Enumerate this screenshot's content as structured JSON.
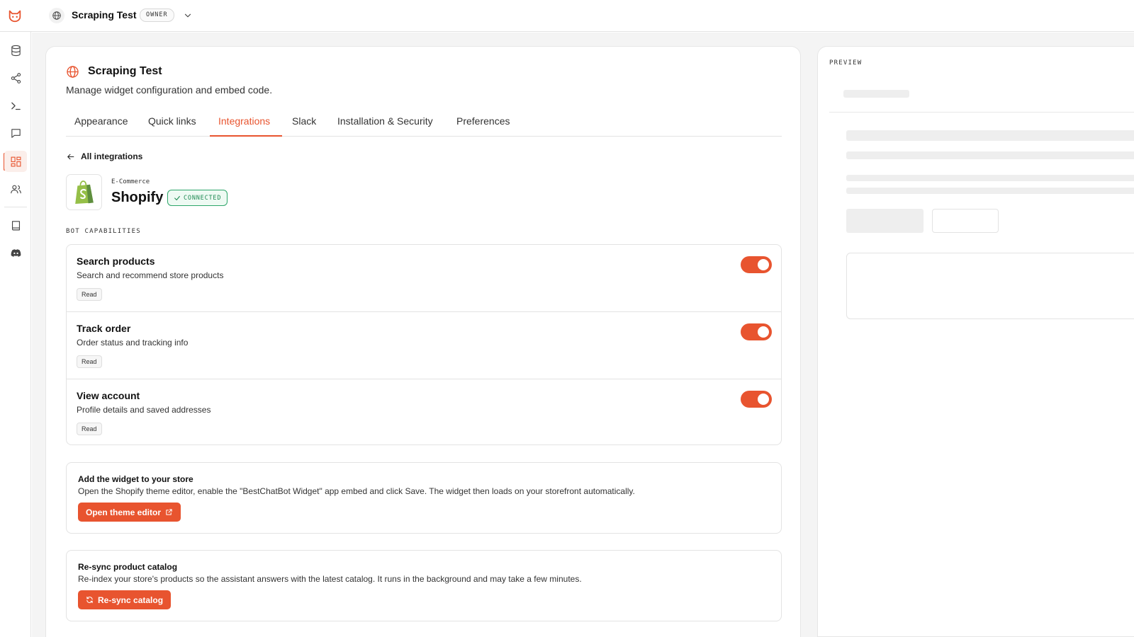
{
  "workspace": {
    "name": "Scraping Test",
    "role": "OWNER"
  },
  "page": {
    "title": "Scraping Test",
    "subtitle": "Manage widget configuration and embed code."
  },
  "tabs": [
    {
      "label": "Appearance"
    },
    {
      "label": "Quick links"
    },
    {
      "label": "Integrations"
    },
    {
      "label": "Slack"
    },
    {
      "label": "Installation & Security"
    },
    {
      "label": "Preferences"
    }
  ],
  "active_tab": "Integrations",
  "back_link": "All integrations",
  "integration": {
    "category": "E-Commerce",
    "name": "Shopify",
    "status": "CONNECTED"
  },
  "capabilities_label": "BOT CAPABILITIES",
  "capabilities": [
    {
      "title": "Search products",
      "description": "Search and recommend store products",
      "badge": "Read",
      "enabled": true
    },
    {
      "title": "Track order",
      "description": "Order status and tracking info",
      "badge": "Read",
      "enabled": true
    },
    {
      "title": "View account",
      "description": "Profile details and saved addresses",
      "badge": "Read",
      "enabled": true
    }
  ],
  "add_widget": {
    "title": "Add the widget to your store",
    "description": "Open the Shopify theme editor, enable the \"BestChatBot Widget\" app embed and click Save. The widget then loads on your storefront automatically.",
    "button": "Open theme editor"
  },
  "resync": {
    "title": "Re-sync product catalog",
    "description": "Re-index your store's products so the assistant answers with the latest catalog. It runs in the background and may take a few minutes.",
    "button": "Re-sync catalog"
  },
  "preview": {
    "label": "PREVIEW"
  },
  "colors": {
    "accent": "#e8542f",
    "success": "#2ea66a",
    "shopify_green": "#95bf47"
  },
  "sidebar_icons": [
    "database-icon",
    "share-icon",
    "terminal-icon",
    "chat-icon",
    "widgets-icon",
    "users-icon",
    "book-icon",
    "discord-icon"
  ]
}
